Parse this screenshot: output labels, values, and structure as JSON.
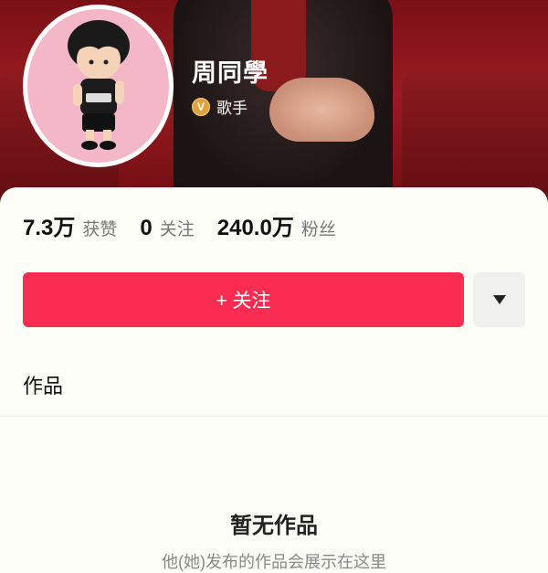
{
  "profile": {
    "name": "周同學",
    "badge_icon": "verified-v-icon",
    "badge_label": "歌手"
  },
  "stats": [
    {
      "value": "7.3万",
      "label": "获赞"
    },
    {
      "value": "0",
      "label": "关注"
    },
    {
      "value": "240.0万",
      "label": "粉丝"
    }
  ],
  "actions": {
    "follow_label": "+ 关注",
    "more_icon": "caret-down-icon"
  },
  "tabs": {
    "works_label": "作品"
  },
  "empty_state": {
    "title": "暂无作品",
    "subtitle": "他(她)发布的作品会展示在这里"
  },
  "colors": {
    "follow_button": "#fb2c52",
    "banner": "#9a1b20",
    "avatar_bg": "#f4b7c8"
  }
}
